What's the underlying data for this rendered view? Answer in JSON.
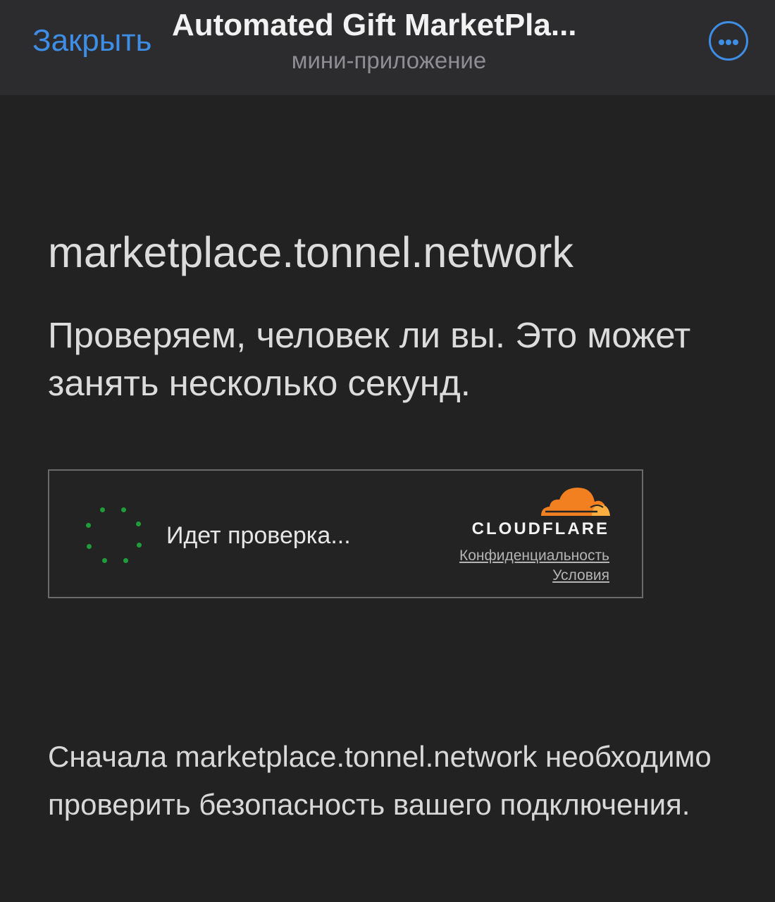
{
  "header": {
    "close_label": "Закрыть",
    "title": "Automated Gift MarketPla...",
    "subtitle": "мини-приложение",
    "more_icon": "more-horizontal-icon",
    "accent_color": "#3e8ee6"
  },
  "main": {
    "domain": "marketplace.tonnel.network",
    "message": "Проверяем, человек ли вы. Это может занять несколько секунд."
  },
  "widget": {
    "spinner_icon": "loading-spinner-icon",
    "verifying_label": "Идет проверка...",
    "brand_icon": "cloudflare-cloud-icon",
    "brand_name": "CLOUDFLARE",
    "brand_color": "#f38020",
    "privacy_label": "Конфиденциальность",
    "terms_label": "Условия"
  },
  "footer": {
    "text": "Сначала marketplace.tonnel.network необходимо проверить безопасность вашего подключения."
  }
}
